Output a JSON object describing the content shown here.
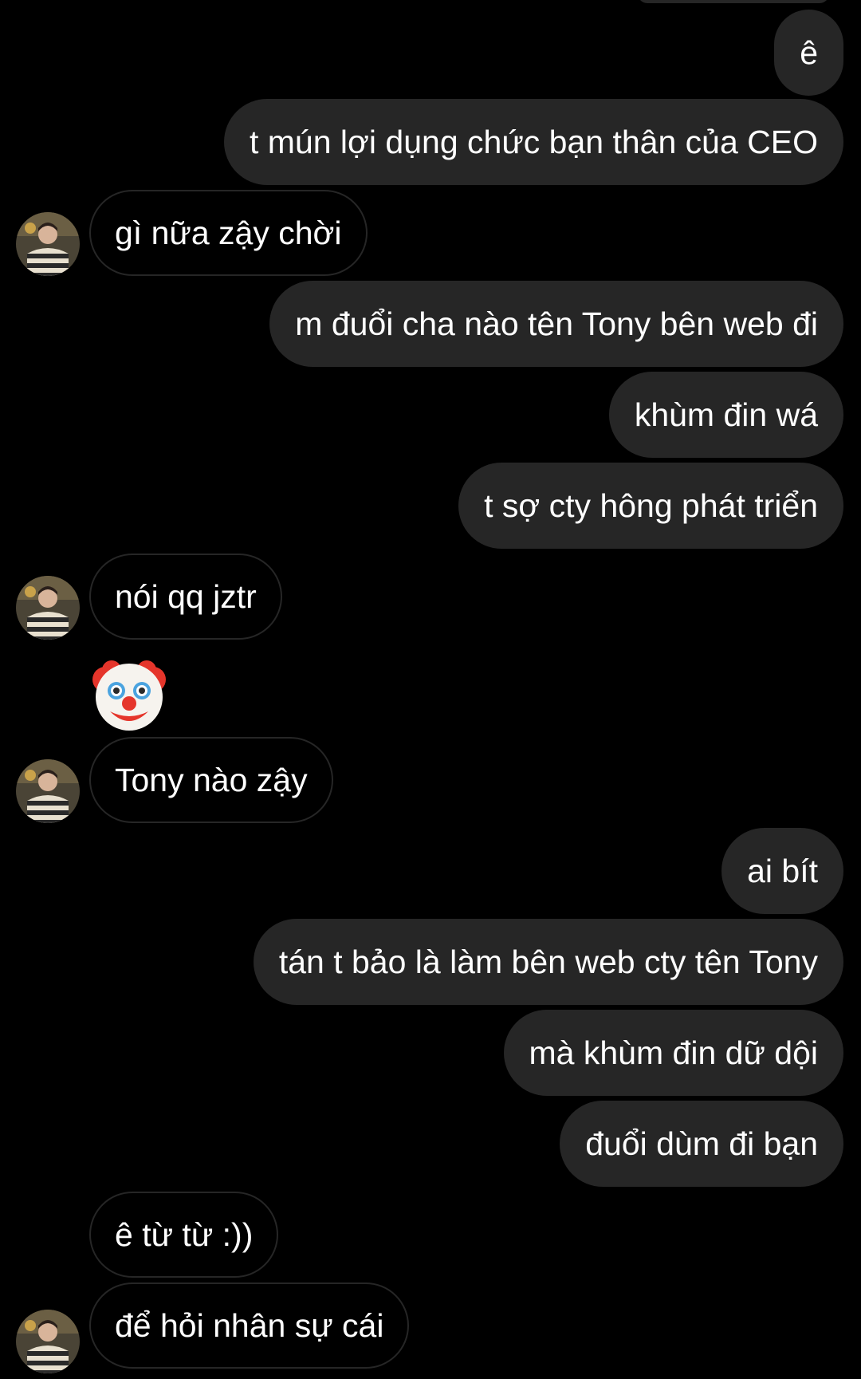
{
  "messages": [
    {
      "side": "out",
      "text": "ê"
    },
    {
      "side": "out",
      "text": "t mún lợi dụng chức bạn thân của CEO"
    },
    {
      "side": "in",
      "text": "gì nữa zậy chời"
    },
    {
      "side": "out",
      "text": "m đuổi cha nào tên Tony bên web đi"
    },
    {
      "side": "out",
      "text": "khùm đin wá"
    },
    {
      "side": "out",
      "text": "t sợ cty hông phát triển"
    },
    {
      "side": "in",
      "text": "nói qq jztr"
    },
    {
      "side": "in",
      "text": "",
      "emoji": "clown-face-emoji"
    },
    {
      "side": "in",
      "text": "Tony nào zậy"
    },
    {
      "side": "out",
      "text": "ai bít"
    },
    {
      "side": "out",
      "text": "tán t bảo là làm bên web cty tên Tony"
    },
    {
      "side": "out",
      "text": "mà khùm đin dữ dội"
    },
    {
      "side": "out",
      "text": "đuổi dùm đi bạn"
    },
    {
      "side": "in",
      "text": "ê từ từ :))"
    },
    {
      "side": "in",
      "text": "để hỏi nhân sự cái"
    }
  ],
  "colors": {
    "background": "#000000",
    "outgoing_bubble": "#262626",
    "incoming_border": "#262626",
    "text": "#ffffff"
  }
}
